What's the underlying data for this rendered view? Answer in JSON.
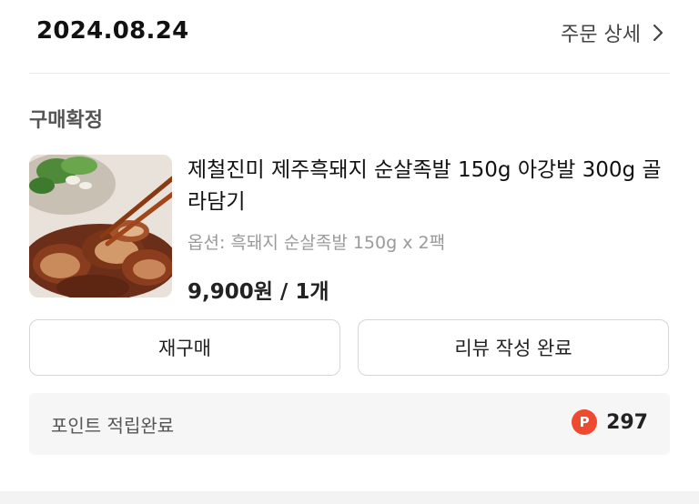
{
  "order": {
    "date": "2024.08.24",
    "detail_link": "주문 상세",
    "status": "구매확정"
  },
  "product": {
    "name": "제철진미 제주흑돼지 순살족발 150g 아강발 300g 골라담기",
    "option": "옵션: 흑돼지 순살족발 150g x 2팩",
    "price": "9,900원 / 1개",
    "image_alt": "sliced jokbal with chopsticks"
  },
  "actions": {
    "repurchase": "재구매",
    "review": "리뷰 작성 완료"
  },
  "points": {
    "label": "포인트 적립완료",
    "icon_letter": "P",
    "value": "297",
    "icon_color": "#ef4a2f"
  }
}
